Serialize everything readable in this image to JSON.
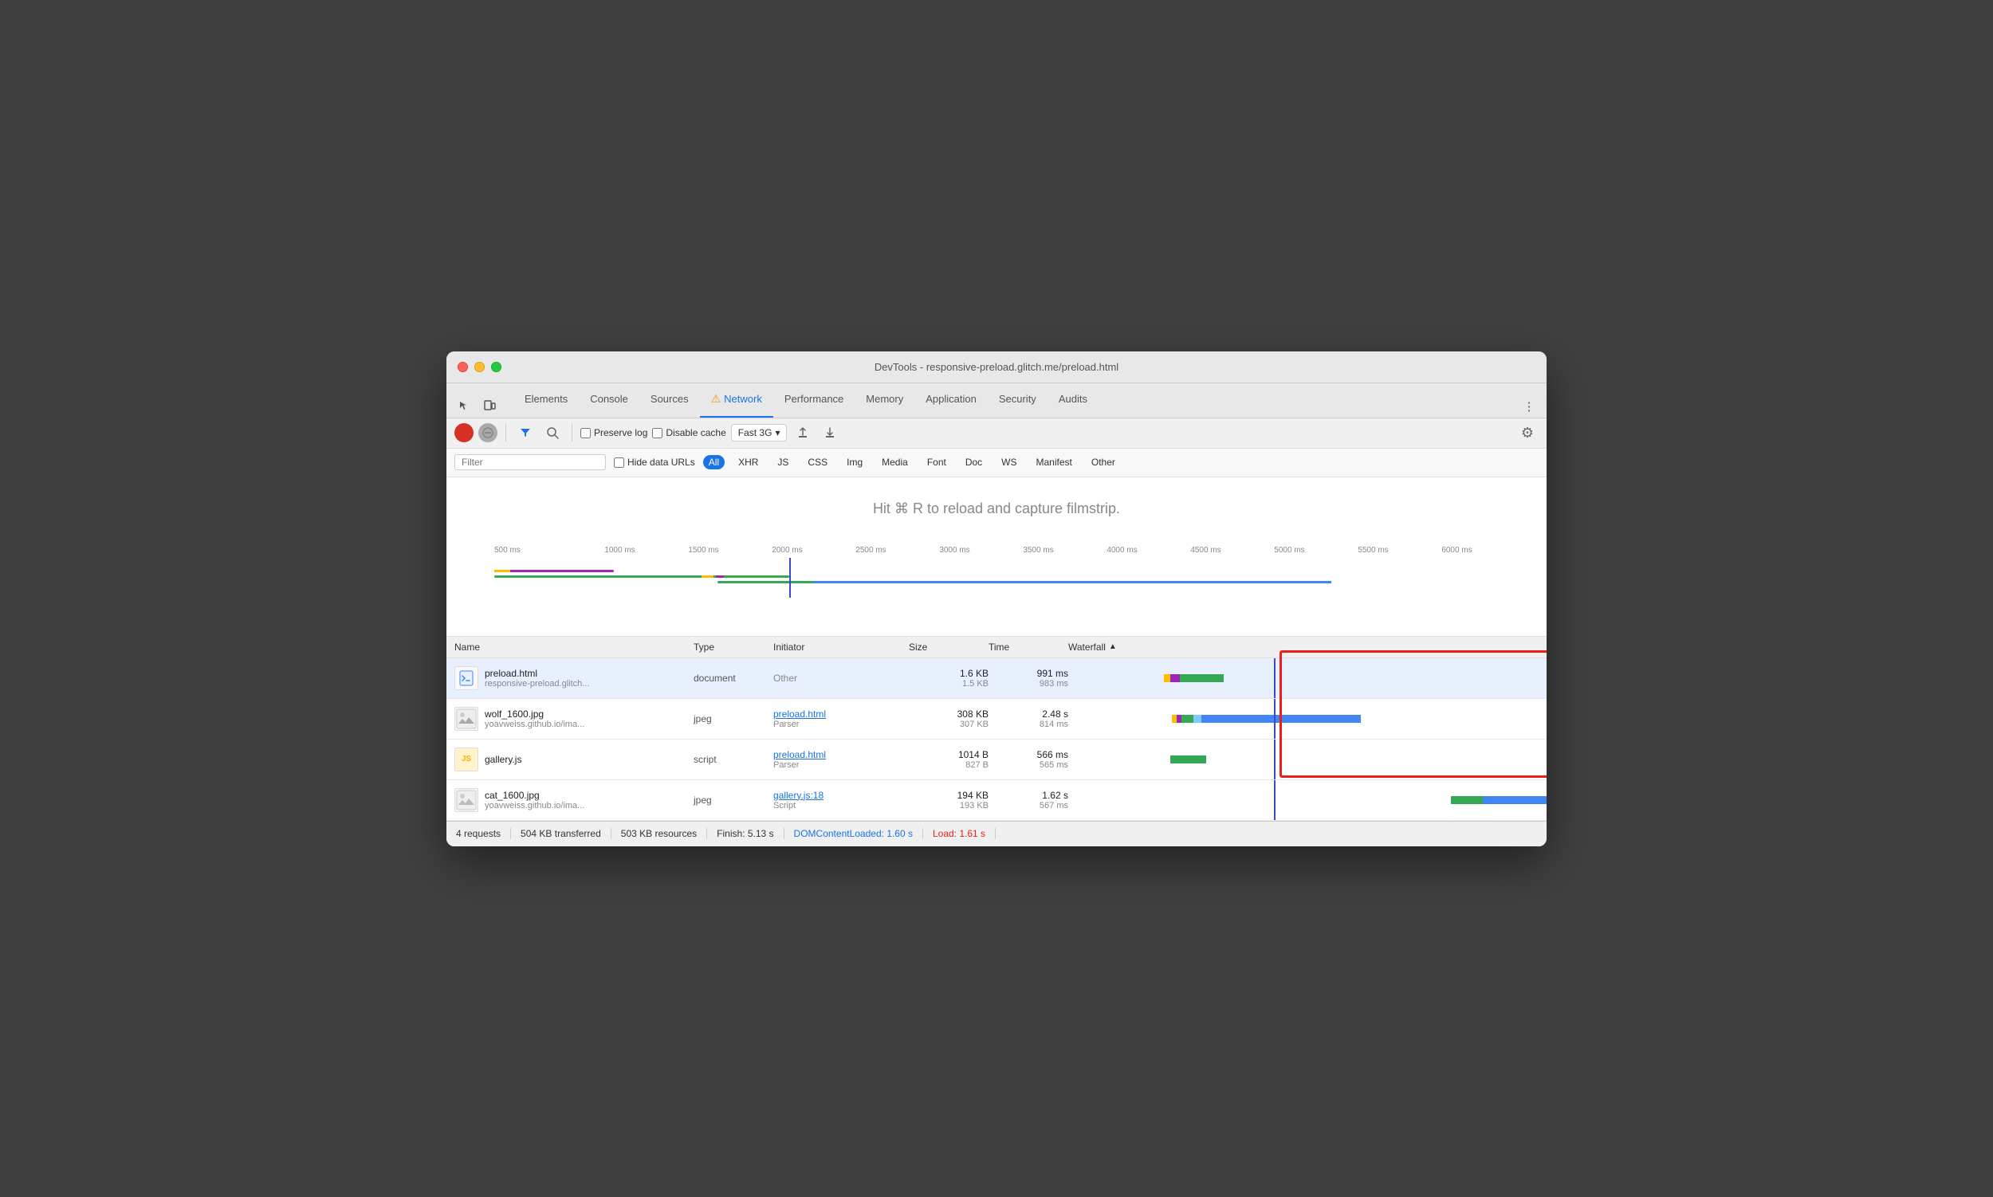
{
  "window": {
    "title": "DevTools - responsive-preload.glitch.me/preload.html"
  },
  "tabs": [
    {
      "id": "elements",
      "label": "Elements",
      "active": false
    },
    {
      "id": "console",
      "label": "Console",
      "active": false
    },
    {
      "id": "sources",
      "label": "Sources",
      "active": false
    },
    {
      "id": "network",
      "label": "Network",
      "active": true,
      "warning": true
    },
    {
      "id": "performance",
      "label": "Performance",
      "active": false
    },
    {
      "id": "memory",
      "label": "Memory",
      "active": false
    },
    {
      "id": "application",
      "label": "Application",
      "active": false
    },
    {
      "id": "security",
      "label": "Security",
      "active": false
    },
    {
      "id": "audits",
      "label": "Audits",
      "active": false
    }
  ],
  "toolbar": {
    "preserve_log_label": "Preserve log",
    "disable_cache_label": "Disable cache",
    "throttle_label": "Fast 3G",
    "settings_icon": "⚙",
    "filter_icon": "⬛",
    "search_icon": "🔍"
  },
  "filterbar": {
    "placeholder": "Filter",
    "hide_data_urls": "Hide data URLs",
    "chips": [
      "All",
      "XHR",
      "JS",
      "CSS",
      "Img",
      "Media",
      "Font",
      "Doc",
      "WS",
      "Manifest",
      "Other"
    ],
    "active_chip": "All"
  },
  "filmstrip": {
    "hint": "Hit ⌘ R to reload and capture filmstrip."
  },
  "ruler": {
    "labels": [
      "500 ms",
      "1000 ms",
      "1500 ms",
      "2000 ms",
      "2500 ms",
      "3000 ms",
      "3500 ms",
      "4000 ms",
      "4500 ms",
      "5000 ms",
      "5500 ms",
      "6000 ms"
    ]
  },
  "table": {
    "headers": [
      "Name",
      "Type",
      "Initiator",
      "Size",
      "Time",
      "Waterfall"
    ],
    "rows": [
      {
        "id": "preload-html",
        "name": "preload.html",
        "url": "responsive-preload.glitch...",
        "type": "document",
        "initiator": "Other",
        "initiator_link": null,
        "size_transfer": "1.6 KB",
        "size_resource": "1.5 KB",
        "time_total": "991 ms",
        "time_latency": "983 ms",
        "selected": true,
        "icon_type": "html"
      },
      {
        "id": "wolf-jpg",
        "name": "wolf_1600.jpg",
        "url": "yoavweiss.github.io/ima...",
        "type": "jpeg",
        "initiator": "preload.html",
        "initiator_sub": "Parser",
        "initiator_link": true,
        "size_transfer": "308 KB",
        "size_resource": "307 KB",
        "time_total": "2.48 s",
        "time_latency": "814 ms",
        "selected": false,
        "icon_type": "img"
      },
      {
        "id": "gallery-js",
        "name": "gallery.js",
        "url": "",
        "type": "script",
        "initiator": "preload.html",
        "initiator_sub": "Parser",
        "initiator_link": true,
        "size_transfer": "1014 B",
        "size_resource": "827 B",
        "time_total": "566 ms",
        "time_latency": "565 ms",
        "selected": false,
        "icon_type": "js"
      },
      {
        "id": "cat-jpg",
        "name": "cat_1600.jpg",
        "url": "yoavweiss.github.io/ima...",
        "type": "jpeg",
        "initiator": "gallery.js:18",
        "initiator_sub": "Script",
        "initiator_link": true,
        "size_transfer": "194 KB",
        "size_resource": "193 KB",
        "time_total": "1.62 s",
        "time_latency": "567 ms",
        "selected": false,
        "icon_type": "img"
      }
    ]
  },
  "statusbar": {
    "requests": "4 requests",
    "transferred": "504 KB transferred",
    "resources": "503 KB resources",
    "finish": "Finish: 5.13 s",
    "dom_loaded": "DOMContentLoaded: 1.60 s",
    "load": "Load: 1.61 s"
  }
}
